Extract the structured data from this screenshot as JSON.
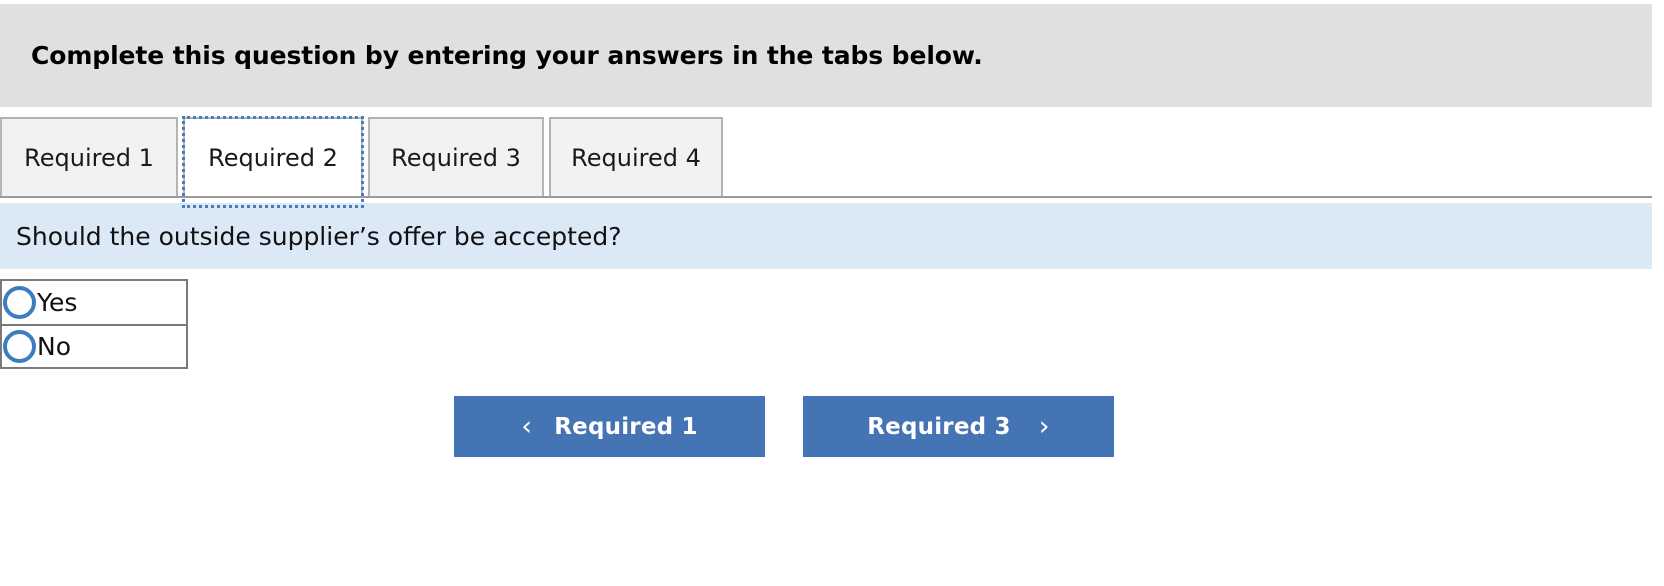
{
  "header": {
    "instruction": "Complete this question by entering your answers in the tabs below."
  },
  "tabs": {
    "items": [
      {
        "label": "Required 1",
        "active": false
      },
      {
        "label": "Required 2",
        "active": true
      },
      {
        "label": "Required 3",
        "active": false
      },
      {
        "label": "Required 4",
        "active": false
      }
    ]
  },
  "question": {
    "text": "Should the outside supplier’s offer be accepted?"
  },
  "answer_options": [
    {
      "label": "Yes",
      "selected": false
    },
    {
      "label": "No",
      "selected": false
    }
  ],
  "navigation": {
    "prev_label": "Required 1",
    "prev_icon": "chevron-left-icon",
    "prev_glyph": "‹",
    "next_label": "Required 3",
    "next_icon": "chevron-right-icon",
    "next_glyph": "›"
  },
  "colors": {
    "header_bg": "#e0e0e0",
    "banner_bg": "#dbe9f7",
    "tab_inactive_bg": "#f2f2f2",
    "tab_active_bg": "#ffffff",
    "focus_outline": "#4a7ebb",
    "button_blue": "#4574b4",
    "radio_blue": "#3e7cc0",
    "border_gray": "#b4b4b4"
  }
}
